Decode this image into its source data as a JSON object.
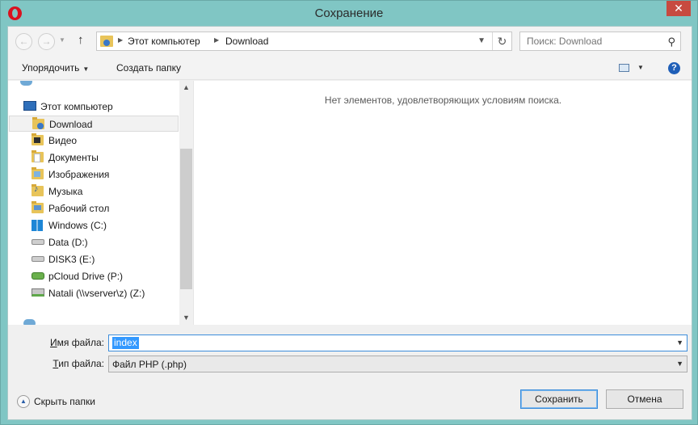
{
  "window": {
    "title": "Сохранение",
    "close_glyph": "✕"
  },
  "nav": {
    "back_glyph": "←",
    "forward_glyph": "→",
    "recent_glyph": "▼",
    "up_glyph": "↑",
    "breadcrumbs": [
      "Этот компьютер",
      "Download"
    ],
    "crumb_sep": "▶",
    "address_dropdown_glyph": "▼",
    "refresh_glyph": "↻",
    "search_placeholder": "Поиск: Download",
    "search_glyph": "⚲"
  },
  "toolbar": {
    "organize_label": "Упорядочить",
    "organize_caret": "▼",
    "new_folder_label": "Создать папку",
    "view_caret": "▼",
    "help_glyph": "?"
  },
  "sidebar": {
    "items": [
      {
        "label": "Этот компьютер",
        "icon": "computer-icon"
      },
      {
        "label": "Download",
        "icon": "downloads-folder-icon",
        "selected": true
      },
      {
        "label": "Видео",
        "icon": "videos-folder-icon"
      },
      {
        "label": "Документы",
        "icon": "documents-folder-icon"
      },
      {
        "label": "Изображения",
        "icon": "pictures-folder-icon"
      },
      {
        "label": "Музыка",
        "icon": "music-folder-icon"
      },
      {
        "label": "Рабочий стол",
        "icon": "desktop-folder-icon"
      },
      {
        "label": "Windows (C:)",
        "icon": "windows-drive-icon"
      },
      {
        "label": "Data (D:)",
        "icon": "hard-drive-icon"
      },
      {
        "label": "DISK3 (E:)",
        "icon": "hard-drive-icon"
      },
      {
        "label": "pCloud Drive (P:)",
        "icon": "cloud-drive-icon"
      },
      {
        "label": "Natali (\\\\vserver\\z) (Z:)",
        "icon": "network-drive-icon"
      }
    ],
    "scroll_up_glyph": "▲",
    "scroll_down_glyph": "▼"
  },
  "content": {
    "empty_message": "Нет элементов, удовлетворяющих условиям поиска."
  },
  "fields": {
    "filename_label_ul": "И",
    "filename_label_rest": "мя файла:",
    "filename_value": "index",
    "filetype_label_ul": "Т",
    "filetype_label_rest": "ип файла:",
    "filetype_value": "Файл PHP (.php)",
    "dropdown_glyph": "▼"
  },
  "footer": {
    "hide_folders_label": "Скрыть папки",
    "hide_glyph": "▲",
    "save_label": "Сохранить",
    "cancel_label": "Отмена"
  },
  "colors": {
    "window_frame": "#80c6c4",
    "close_button": "#c74a40",
    "selection": "#3399ff",
    "focus_border": "#3c8ddb"
  }
}
